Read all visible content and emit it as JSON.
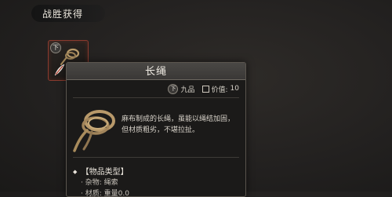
{
  "header": {
    "victory_label": "战胜获得"
  },
  "slot": {
    "grade": "下"
  },
  "tooltip": {
    "title": "长绳",
    "grade_badge": "下",
    "grade_text": "九品",
    "value_label": "价值:",
    "value": "10",
    "description": "麻布制成的长绳，虽能以绳结加固，但材质粗劣，不堪拉扯。",
    "section_title": "【物品类型】",
    "properties": [
      {
        "text": "杂物: 绳索"
      },
      {
        "text": "材质: 重量0.0"
      }
    ]
  },
  "colors": {
    "slot_border": "#8a3a2e",
    "panel_bg": "#1b1a19",
    "header_bg": "#3a3836"
  },
  "icons": {
    "slot_item": "rope-icon",
    "slot_sub": "feather-icon",
    "value": "value-box-icon"
  }
}
